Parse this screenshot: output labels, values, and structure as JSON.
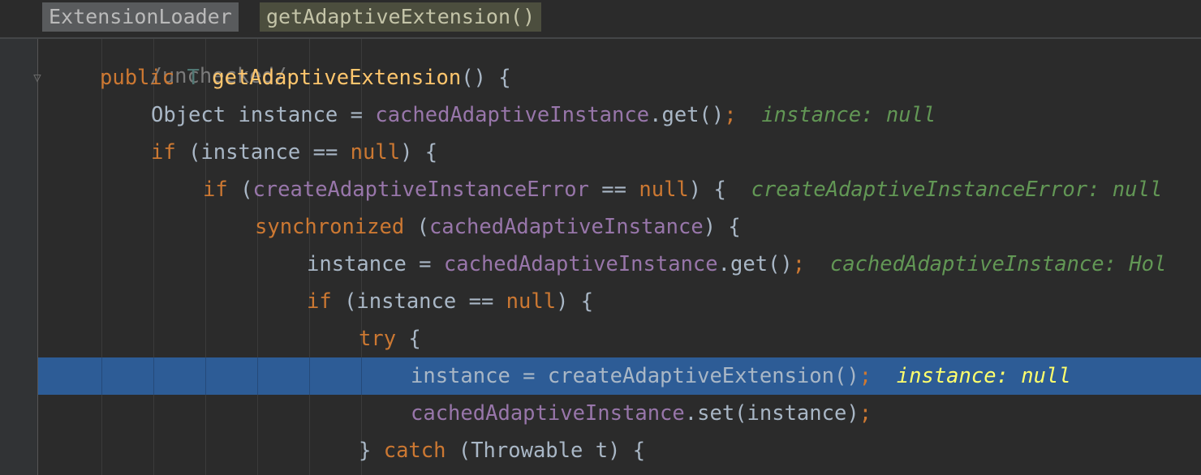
{
  "breadcrumbs": {
    "class_name": "ExtensionLoader",
    "method_name": "getAdaptiveExtension()"
  },
  "gutter": {
    "fold_icon": "fold-icon"
  },
  "code": {
    "line0": "/unchecked/",
    "line1_kw": "public",
    "line1_type": "T",
    "line1_fn": "getAdaptiveExtension",
    "line1_rest": "() {",
    "line2_a": "Object instance = ",
    "line2_field": "cachedAdaptiveInstance",
    "line2_b": ".get()",
    "line2_semi": ";",
    "line2_hint": "instance: null",
    "line3_kw": "if",
    "line3_a": " (instance == ",
    "line3_null": "null",
    "line3_b": ") {",
    "line4_kw": "if",
    "line4_a": " (",
    "line4_field": "createAdaptiveInstanceError",
    "line4_b": " == ",
    "line4_null": "null",
    "line4_c": ") {",
    "line4_hint": "createAdaptiveInstanceError: null",
    "line5_kw": "synchronized",
    "line5_a": " (",
    "line5_field": "cachedAdaptiveInstance",
    "line5_b": ") {",
    "line6_a": "instance = ",
    "line6_field": "cachedAdaptiveInstance",
    "line6_b": ".get()",
    "line6_semi": ";",
    "line6_hint": "cachedAdaptiveInstance: Hol",
    "line7_kw": "if",
    "line7_a": " (instance == ",
    "line7_null": "null",
    "line7_b": ") {",
    "line8_kw": "try",
    "line8_a": " {",
    "line9_a": "instance = createAdaptiveExtension()",
    "line9_semi": ";",
    "line9_hint": "instance: null",
    "line10_field": "cachedAdaptiveInstance",
    "line10_a": ".set(instance)",
    "line10_semi": ";",
    "line11_a": "} ",
    "line11_kw": "catch",
    "line11_b": " (Throwable t) {"
  },
  "colors": {
    "background": "#2b2b2b",
    "keyword": "#cc7832",
    "field": "#9876aa",
    "method": "#ffc66d",
    "hint": "#629755",
    "highlight_line": "#2d5c96",
    "hint_highlighted": "#ffff6c"
  }
}
